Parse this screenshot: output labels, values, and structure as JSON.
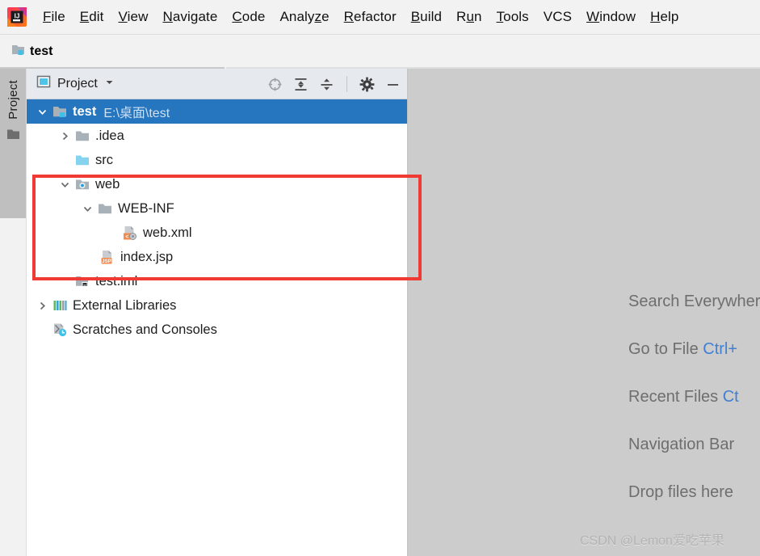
{
  "window": {
    "app_icon": "intellij-idea-logo",
    "menu": [
      {
        "label": "File",
        "mnemonic": "F"
      },
      {
        "label": "Edit",
        "mnemonic": "E"
      },
      {
        "label": "View",
        "mnemonic": "V"
      },
      {
        "label": "Navigate",
        "mnemonic": "N"
      },
      {
        "label": "Code",
        "mnemonic": "C"
      },
      {
        "label": "Analyze",
        "mnemonic": "z"
      },
      {
        "label": "Refactor",
        "mnemonic": "R"
      },
      {
        "label": "Build",
        "mnemonic": "B"
      },
      {
        "label": "Run",
        "mnemonic": "u"
      },
      {
        "label": "Tools",
        "mnemonic": "T"
      },
      {
        "label": "VCS",
        "mnemonic": ""
      },
      {
        "label": "Window",
        "mnemonic": "W"
      },
      {
        "label": "Help",
        "mnemonic": "H"
      }
    ]
  },
  "navbar": {
    "crumb_icon": "project-folder-icon",
    "crumb_label": "test"
  },
  "toolstripe": {
    "tab_label": "Project",
    "tab_icon": "folder-icon"
  },
  "project_tool_window": {
    "title": "Project",
    "title_icon": "project-view-icon",
    "dropdown_icon": "chevron-down-icon",
    "actions": [
      {
        "name": "select-opened-file-icon",
        "title": "Select Opened File"
      },
      {
        "name": "expand-all-icon",
        "title": "Expand All"
      },
      {
        "name": "collapse-all-icon",
        "title": "Collapse All"
      },
      {
        "name": "settings-gear-icon",
        "title": "Settings"
      },
      {
        "name": "hide-minimize-icon",
        "title": "Hide"
      }
    ]
  },
  "tree": {
    "rows": [
      {
        "label": "test",
        "sublabel": "E:\\桌面\\test",
        "icon": "project-root-icon",
        "twisty": "expanded",
        "indent": 0,
        "selected": true
      },
      {
        "label": ".idea",
        "sublabel": "",
        "icon": "folder-grey-icon",
        "twisty": "collapsed",
        "indent": 1,
        "selected": false
      },
      {
        "label": "src",
        "sublabel": "",
        "icon": "folder-source-icon",
        "twisty": "none",
        "indent": 1,
        "selected": false
      },
      {
        "label": "web",
        "sublabel": "",
        "icon": "folder-web-root-icon",
        "twisty": "expanded",
        "indent": 1,
        "selected": false
      },
      {
        "label": "WEB-INF",
        "sublabel": "",
        "icon": "folder-grey-icon",
        "twisty": "expanded",
        "indent": 2,
        "selected": false
      },
      {
        "label": "web.xml",
        "sublabel": "",
        "icon": "xml-file-icon",
        "twisty": "none",
        "indent": 3,
        "selected": false
      },
      {
        "label": "index.jsp",
        "sublabel": "",
        "icon": "jsp-file-icon",
        "twisty": "none",
        "indent": 2,
        "selected": false
      },
      {
        "label": "test.iml",
        "sublabel": "",
        "icon": "iml-module-file-icon",
        "twisty": "none",
        "indent": 1,
        "selected": false
      },
      {
        "label": "External Libraries",
        "sublabel": "",
        "icon": "libraries-icon",
        "twisty": "collapsed",
        "indent": 0,
        "selected": false
      },
      {
        "label": "Scratches and Consoles",
        "sublabel": "",
        "icon": "scratches-icon",
        "twisty": "none",
        "indent": 0,
        "selected": false
      }
    ]
  },
  "editor": {
    "hints": [
      {
        "text": "Search Everywhere",
        "shortcut": ""
      },
      {
        "text": "Go to File ",
        "shortcut": "Ctrl+"
      },
      {
        "text": "Recent Files ",
        "shortcut": "Ct"
      },
      {
        "text": "Navigation Bar",
        "shortcut": ""
      },
      {
        "text": "Drop files here",
        "shortcut": ""
      }
    ],
    "watermark": "CSDN @Lemon爱吃苹果"
  },
  "annotation": {
    "type": "red-rectangle-highlight"
  },
  "colors": {
    "selection_blue": "#2675bf",
    "annotation_red": "#f03a34",
    "editor_bg": "#cccccc",
    "toolwindow_header": "#e6e9ed",
    "hint_key_blue": "#3f7fd4"
  }
}
